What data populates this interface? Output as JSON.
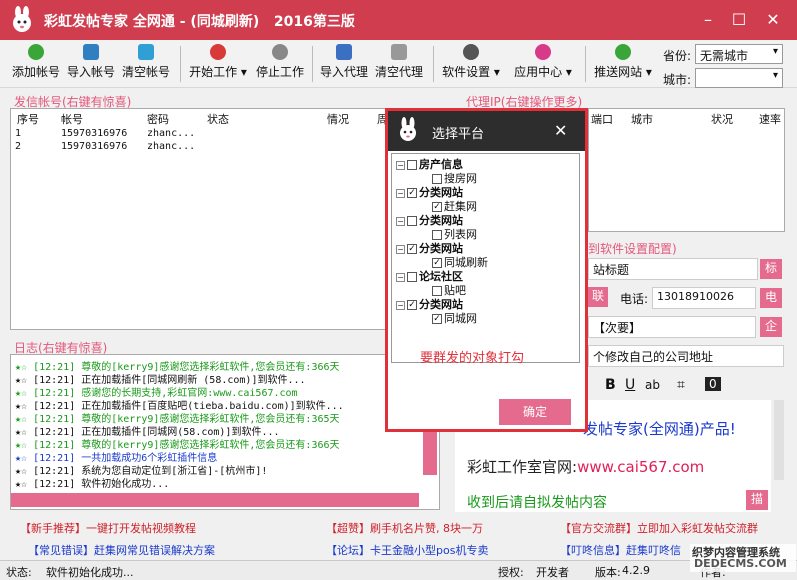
{
  "window": {
    "title": "彩虹发帖专家 全网通 - (同城刷新)",
    "edition": "2016第三版",
    "controls": {
      "minimize": "–",
      "maximize": "☐",
      "close": "✕"
    }
  },
  "toolbar": {
    "buttons": [
      {
        "label": "添加帐号",
        "icon": "add-icon",
        "color": "#3aa63a"
      },
      {
        "label": "导入帐号",
        "icon": "import-icon",
        "color": "#2f7fc1"
      },
      {
        "label": "清空帐号",
        "icon": "clear-icon",
        "color": "#2f9fd6"
      },
      {
        "label": "开始工作",
        "icon": "play-icon",
        "color": "#d83a3a"
      },
      {
        "label": "停止工作",
        "icon": "stop-icon",
        "color": "#888888"
      },
      {
        "label": "导入代理",
        "icon": "proxy-import-icon",
        "color": "#3a6fc1"
      },
      {
        "label": "清空代理",
        "icon": "trash-icon",
        "color": "#888888"
      },
      {
        "label": "软件设置",
        "icon": "gear-icon",
        "color": "#555555"
      },
      {
        "label": "应用中心",
        "icon": "apps-icon",
        "color": "#d83a8a"
      },
      {
        "label": "推送网站",
        "icon": "push-icon",
        "color": "#3aa63a"
      }
    ],
    "province_label": "省份:",
    "province_value": "无需城市",
    "city_label": "城市:",
    "city_value": ""
  },
  "accounts": {
    "title": "发信帐号(右键有惊喜)",
    "columns": [
      "序号",
      "帐号",
      "密码",
      "状态",
      "情况",
      "周"
    ],
    "rows": [
      [
        "1",
        "15970316976",
        "zhanc...",
        "",
        "",
        ""
      ],
      [
        "2",
        "15970316976",
        "zhanc...",
        "",
        "",
        ""
      ]
    ]
  },
  "proxy": {
    "title": "代理IP(右键操作更多)",
    "columns": [
      "端口",
      "城市",
      "状况",
      "速率"
    ]
  },
  "log": {
    "title": "日志(右键有惊喜)",
    "lines": [
      {
        "mark": "★☆",
        "text": "[12:21] 尊敬的[kerry9]感谢您选择彩虹软件,您会员还有:366天",
        "color": "#1a9a1a",
        "mark_color": "#1a9a1a"
      },
      {
        "mark": "★☆",
        "text": "[12:21] 正在加载插件[同城网刷新 (58.com)]到软件...",
        "color": "#111111",
        "mark_color": "#111111"
      },
      {
        "mark": "★☆",
        "text": "[12:21] 感谢您的长期支持,彩虹官网:www.cai567.com",
        "color": "#1a9a1a",
        "mark_color": "#1a9a1a"
      },
      {
        "mark": "★☆",
        "text": "[12:21] 正在加载插件[百度贴吧(tieba.baidu.com)]到软件...",
        "color": "#111111",
        "mark_color": "#111111"
      },
      {
        "mark": "★☆",
        "text": "[12:21] 尊敬的[kerry9]感谢您选择彩虹软件,您会员还有:365天",
        "color": "#1a9a1a",
        "mark_color": "#1a9a1a"
      },
      {
        "mark": "★☆",
        "text": "[12:21] 正在加载插件[同城网(58.com)]到软件...",
        "color": "#111111",
        "mark_color": "#111111"
      },
      {
        "mark": "★☆",
        "text": "[12:21] 尊敬的[kerry9]感谢您选择彩虹软件,您会员还有:366天",
        "color": "#1a9a1a",
        "mark_color": "#1a9a1a"
      },
      {
        "mark": "★☆",
        "text": "[12:21] 一共加载成功6个彩虹插件信息",
        "color": "#1a3acc",
        "mark_color": "#1a3acc"
      },
      {
        "mark": "★☆",
        "text": "[12:21] 系统为您自动定位到[浙江省]-[杭州市]!",
        "color": "#111111",
        "mark_color": "#111111"
      },
      {
        "mark": "★☆",
        "text": "[12:21] 软件初始化成功...",
        "color": "#111111",
        "mark_color": "#111111"
      }
    ]
  },
  "config": {
    "title": "到软件设置配置)",
    "title_button": "标",
    "phone_label": "电话:",
    "phone_value": "13018910026",
    "phone_button": "电",
    "contact_button": "联",
    "next_field": "【次要】",
    "company_button": "企",
    "address_hint": "个修改自己的公司地址",
    "editor_tools": [
      "B",
      "U",
      "ab",
      "⌗",
      "0"
    ],
    "body_line1": "发帖专家(全网通)产品!",
    "body_line2_label": "彩虹工作室官网:",
    "body_line2_url": "www.cai567.com",
    "body_line3": "收到后请自拟发帖内容",
    "desc_button": "描",
    "subject_label": "站标题"
  },
  "dialog": {
    "title": "选择平台",
    "close": "✕",
    "tree": [
      {
        "label": "房产信息",
        "level": 0,
        "checked": false,
        "expander": "⊟"
      },
      {
        "label": "搜房网",
        "level": 1,
        "checked": false
      },
      {
        "label": "分类网站",
        "level": 0,
        "checked": true,
        "expander": "⊟"
      },
      {
        "label": "赶集网",
        "level": 1,
        "checked": true
      },
      {
        "label": "分类网站",
        "level": 0,
        "checked": false,
        "expander": "⊟"
      },
      {
        "label": "列表网",
        "level": 1,
        "checked": false
      },
      {
        "label": "分类网站",
        "level": 0,
        "checked": true,
        "expander": "⊟"
      },
      {
        "label": "同城刷新",
        "level": 1,
        "checked": true
      },
      {
        "label": "论坛社区",
        "level": 0,
        "checked": false,
        "expander": "⊟"
      },
      {
        "label": "贴吧",
        "level": 1,
        "checked": false
      },
      {
        "label": "分类网站",
        "level": 0,
        "checked": true,
        "expander": "⊟"
      },
      {
        "label": "同城网",
        "level": 1,
        "checked": true
      }
    ],
    "hint": "要群发的对象打勾",
    "confirm": "确定"
  },
  "links": [
    {
      "tag": "【新手推荐】",
      "text": "一键打开发帖视频教程"
    },
    {
      "tag": "【超赞】",
      "text": "刷手机名片赞, 8块一万"
    },
    {
      "tag": "【官方交流群】",
      "text": "立即加入彩虹发帖交流群"
    },
    {
      "tag": "【常见错误】",
      "text": "赶集网常见错误解决方案"
    },
    {
      "tag": "【论坛】",
      "text": "卡王金融小型pos机专卖"
    },
    {
      "tag": "【叮咚信息】",
      "text": "赶集叮咚信"
    }
  ],
  "status": {
    "label": "状态:",
    "text": "软件初始化成功...",
    "auth_label": "授权:",
    "auth_value": "开发者",
    "version_label": "版本:",
    "version_value": "4.2.9",
    "extra_label": "作者:"
  },
  "watermark": {
    "line1": "织梦内容管理系统",
    "line2": "DEDECMS.COM"
  }
}
